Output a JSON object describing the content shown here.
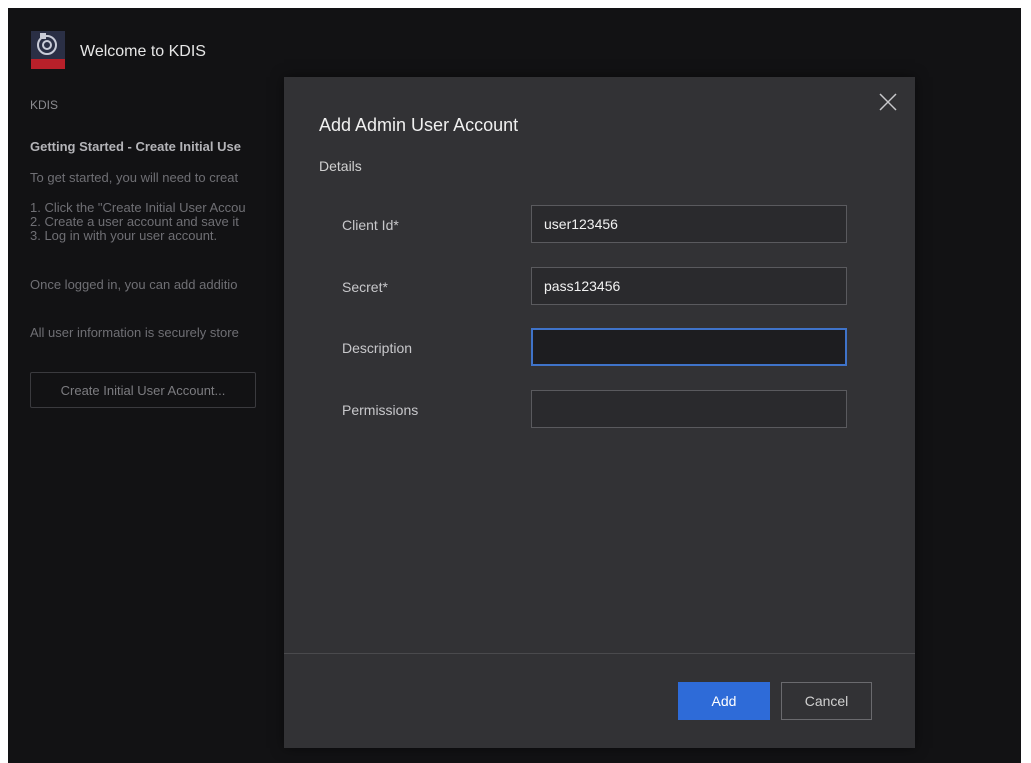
{
  "app": {
    "title": "Welcome to KDIS"
  },
  "background": {
    "breadcrumb": "KDIS",
    "heading": "Getting Started - Create Initial Use",
    "intro": "To get started, you will need to creat",
    "steps": [
      "1. Click the \"Create Initial User Accou",
      "2. Create a user account and save it",
      "3. Log in with your user account."
    ],
    "logged_in_text": "Once logged in, you can add additio",
    "secure_text": "All user information is securely store",
    "create_button": "Create Initial User Account..."
  },
  "dialog": {
    "title": "Add Admin User Account",
    "section": "Details",
    "fields": [
      {
        "label": "Client Id*",
        "value": "user123456",
        "placeholder": ""
      },
      {
        "label": "Secret*",
        "value": "pass123456",
        "placeholder": ""
      },
      {
        "label": "Description",
        "value": "",
        "placeholder": ""
      },
      {
        "label": "Permissions",
        "value": "",
        "placeholder": ""
      }
    ],
    "add_label": "Add",
    "cancel_label": "Cancel"
  },
  "colors": {
    "accent": "#2e6bd8",
    "focus_border": "#3f73c9",
    "dialog_bg": "#323235",
    "page_bg": "#121214"
  },
  "icons": {
    "logo": "kdis-logo-icon",
    "close": "close-icon"
  }
}
